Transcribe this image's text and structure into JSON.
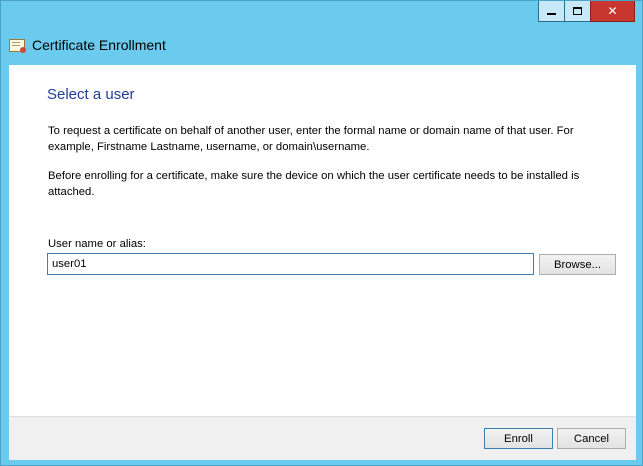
{
  "window": {
    "title": "Certificate Enrollment",
    "icon": "certificate-icon",
    "caption": {
      "minimize": "minimize-icon",
      "maximize": "maximize-icon",
      "close_label": "✕"
    }
  },
  "page": {
    "heading": "Select a user",
    "description": "To request a certificate on behalf of another user, enter the formal name or domain name of that user. For example, Firstname Lastname, username, or domain\\username.",
    "note": "Before enrolling for a certificate, make sure the device on which the user certificate needs to be installed is attached.",
    "field_label": "User name or alias:",
    "field_value": "user01",
    "browse_label": "Browse..."
  },
  "footer": {
    "enroll_label": "Enroll",
    "cancel_label": "Cancel"
  }
}
